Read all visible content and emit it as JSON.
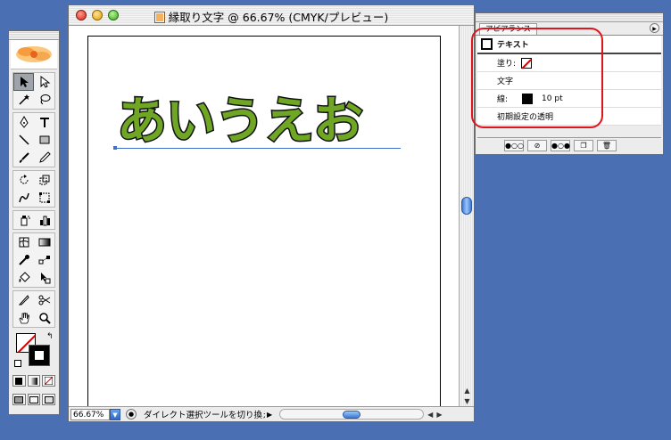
{
  "document": {
    "title": "縁取り文字 @ 66.67% (CMYK/プレビュー)",
    "artwork_text": "あいうえお"
  },
  "status_bar": {
    "zoom": "66.67%",
    "message": "ダイレクト選択ツールを切り換え"
  },
  "appearance_panel": {
    "tab_label": "アピアランス",
    "header": "テキスト",
    "rows": [
      {
        "label": "塗り:"
      },
      {
        "label": "文字"
      },
      {
        "label": "線:",
        "value": "10 pt"
      },
      {
        "label": "初期設定の透明"
      }
    ]
  },
  "colors": {
    "desktop": "#4a6fb3",
    "text_fill": "#6fa624",
    "text_stroke": "#111111",
    "highlight": "#e0151b",
    "selection": "#3d6fd1"
  },
  "tools": [
    "selection-tool",
    "direct-selection-tool",
    "magic-wand-tool",
    "lasso-tool",
    "pen-tool",
    "type-tool",
    "line-tool",
    "rectangle-tool",
    "paintbrush-tool",
    "pencil-tool",
    "rotate-tool",
    "scale-tool",
    "warp-tool",
    "free-transform-tool",
    "symbol-sprayer-tool",
    "graph-tool",
    "mesh-tool",
    "gradient-tool",
    "eyedropper-tool",
    "blend-tool",
    "live-paint-tool",
    "slice-select-tool",
    "knife-tool",
    "scissors-tool",
    "hand-tool",
    "zoom-tool"
  ]
}
